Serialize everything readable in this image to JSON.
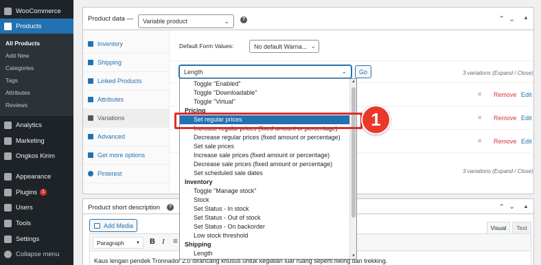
{
  "sidebar": {
    "woocommerce": "WooCommerce",
    "products": "Products",
    "submenu": [
      "All Products",
      "Add New",
      "Categories",
      "Tags",
      "Attributes",
      "Reviews"
    ],
    "items": [
      {
        "label": "Analytics",
        "icon": "bar-chart-icon"
      },
      {
        "label": "Marketing",
        "icon": "megaphone-icon"
      },
      {
        "label": "Ongkos Kirim",
        "icon": "truck-icon"
      },
      {
        "label": "Appearance",
        "icon": "paintbrush-icon"
      },
      {
        "label": "Plugins",
        "icon": "plug-icon",
        "badge": "1"
      },
      {
        "label": "Users",
        "icon": "user-icon"
      },
      {
        "label": "Tools",
        "icon": "wrench-icon"
      },
      {
        "label": "Settings",
        "icon": "settings-icon"
      },
      {
        "label": "Collapse menu",
        "icon": "collapse-icon"
      }
    ]
  },
  "product_data": {
    "title": "Product data —",
    "type_value": "Variable product",
    "help": "?",
    "tabs": [
      "Inventory",
      "Shipping",
      "Linked Products",
      "Attributes",
      "Variations",
      "Advanced",
      "Get more options",
      "Pinterest"
    ],
    "default_form_label": "Default Form Values:",
    "default_form_value": "No default Warna...",
    "action_select_value": "Length",
    "go_label": "Go",
    "variations_info": "3 variations (Expand / Close)",
    "remove_label": "Remove",
    "edit_label": "Edit"
  },
  "dropdown": {
    "top_options": [
      "Toggle \"Enabled\"",
      "Toggle \"Downloadable\"",
      "Toggle \"Virtual\""
    ],
    "groups": [
      {
        "name": "Pricing",
        "options": [
          "Set regular prices",
          "Increase regular prices (fixed amount or percentage)",
          "Decrease regular prices (fixed amount or percentage)",
          "Set sale prices",
          "Increase sale prices (fixed amount or percentage)",
          "Decrease sale prices (fixed amount or percentage)",
          "Set scheduled sale dates"
        ]
      },
      {
        "name": "Inventory",
        "options": [
          "Toggle \"Manage stock\"",
          "Stock",
          "Set Status - In stock",
          "Set Status - Out of stock",
          "Set Status - On backorder",
          "Low stock threshold"
        ]
      },
      {
        "name": "Shipping",
        "options": [
          "Length"
        ]
      }
    ],
    "highlighted": "Set regular prices"
  },
  "callout": {
    "number": "1",
    "color": "#e8392a"
  },
  "short_description": {
    "title": "Product short description",
    "help": "?",
    "add_media": "Add Media",
    "tab_visual": "Visual",
    "tab_text": "Text",
    "format_value": "Paragraph",
    "bold": "B",
    "italic": "I",
    "content": "Kaus lengan pendek Tronnador 2.0 dirancang khusus untuk kegiatan luar ruang seperti hiking dan trekking."
  },
  "colors": {
    "accent": "#2271b1",
    "sidebar_bg": "#1d2327",
    "highlight_box": "#e02a2a",
    "remove": "#d63638"
  }
}
